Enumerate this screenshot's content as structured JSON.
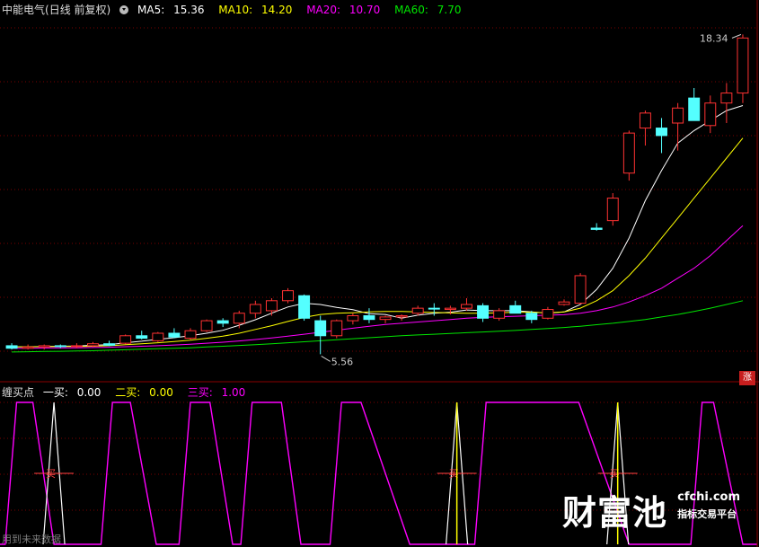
{
  "main_header": {
    "stock_name": "中能电气",
    "period": "(日线 前复权)",
    "ma5_label": "MA5:",
    "ma5_value": "15.36",
    "ma10_label": "MA10:",
    "ma10_value": "14.20",
    "ma20_label": "MA20:",
    "ma20_value": "10.70",
    "ma60_label": "MA60:",
    "ma60_value": "7.70"
  },
  "indicator_header": {
    "name": "缠买点",
    "buy1_label": "一买:",
    "buy1_value": "0.00",
    "buy2_label": "二买:",
    "buy2_value": "0.00",
    "buy3_label": "三买:",
    "buy3_value": "1.00"
  },
  "badges": {
    "rise": "涨"
  },
  "footer": {
    "no_future": "用到未来数据"
  },
  "watermark": {
    "brand": "财富池",
    "url": "cfchi.com",
    "slogan": "指标交易平台"
  },
  "colors": {
    "up": "#ff3232",
    "down": "#54ffff",
    "ma5": "#ffffff",
    "ma10": "#ffff00",
    "ma20": "#ff00ff",
    "ma60": "#00e600",
    "grid": "#7a0000",
    "buy1": "#ffffff",
    "buy2": "#ffff00",
    "buy3": "#ff00ff"
  },
  "chart_data": [
    {
      "type": "candlestick",
      "title": "中能电气 (日线 前复权)",
      "annotations": [
        {
          "text": "18.34",
          "x": 46,
          "y": 18.34
        },
        {
          "text": "5.56",
          "x": 20,
          "y": 5.56
        }
      ],
      "ylim": [
        5.0,
        19.0
      ],
      "x": [
        1,
        2,
        3,
        4,
        5,
        6,
        7,
        8,
        9,
        10,
        11,
        12,
        13,
        14,
        15,
        16,
        17,
        18,
        19,
        20,
        21,
        22,
        23,
        24,
        25,
        26,
        27,
        28,
        29,
        30,
        31,
        32,
        33,
        34,
        35,
        36,
        37,
        38,
        39,
        40,
        41,
        42,
        43,
        44,
        45,
        46
      ],
      "candles": [
        [
          5.9,
          6.0,
          5.75,
          5.8
        ],
        [
          5.8,
          5.95,
          5.75,
          5.85
        ],
        [
          5.85,
          5.95,
          5.75,
          5.9
        ],
        [
          5.9,
          5.95,
          5.8,
          5.88
        ],
        [
          5.88,
          6.0,
          5.8,
          5.9
        ],
        [
          5.9,
          6.05,
          5.85,
          5.98
        ],
        [
          5.98,
          6.1,
          5.88,
          5.92
        ],
        [
          6.0,
          6.35,
          5.95,
          6.3
        ],
        [
          6.3,
          6.5,
          6.15,
          6.2
        ],
        [
          6.1,
          6.45,
          6.05,
          6.4
        ],
        [
          6.4,
          6.6,
          6.2,
          6.25
        ],
        [
          6.2,
          6.6,
          6.15,
          6.5
        ],
        [
          6.5,
          6.95,
          6.45,
          6.9
        ],
        [
          6.9,
          7.0,
          6.65,
          6.8
        ],
        [
          6.8,
          7.3,
          6.6,
          7.2
        ],
        [
          7.2,
          7.7,
          7.0,
          7.55
        ],
        [
          7.3,
          7.8,
          7.1,
          7.7
        ],
        [
          7.7,
          8.2,
          7.6,
          8.1
        ],
        [
          7.9,
          7.95,
          6.9,
          7.0
        ],
        [
          6.9,
          7.1,
          5.56,
          6.3
        ],
        [
          6.3,
          6.95,
          6.2,
          6.9
        ],
        [
          6.9,
          7.2,
          6.75,
          7.1
        ],
        [
          7.1,
          7.4,
          6.8,
          6.95
        ],
        [
          6.95,
          7.1,
          6.8,
          7.05
        ],
        [
          7.05,
          7.15,
          6.9,
          7.1
        ],
        [
          7.2,
          7.5,
          7.1,
          7.4
        ],
        [
          7.4,
          7.6,
          7.1,
          7.38
        ],
        [
          7.35,
          7.5,
          7.15,
          7.4
        ],
        [
          7.4,
          7.8,
          7.3,
          7.55
        ],
        [
          7.5,
          7.6,
          6.85,
          7.0
        ],
        [
          7.0,
          7.4,
          6.9,
          7.3
        ],
        [
          7.5,
          7.7,
          7.3,
          7.2
        ],
        [
          7.2,
          7.3,
          6.8,
          6.95
        ],
        [
          7.0,
          7.45,
          6.95,
          7.35
        ],
        [
          7.55,
          7.75,
          7.5,
          7.65
        ],
        [
          7.6,
          8.8,
          7.55,
          8.7
        ],
        [
          10.6,
          10.8,
          10.5,
          10.55
        ],
        [
          10.9,
          12.0,
          10.7,
          11.8
        ],
        [
          12.8,
          14.5,
          12.5,
          14.4
        ],
        [
          14.6,
          15.3,
          13.9,
          15.2
        ],
        [
          14.6,
          15.0,
          13.6,
          14.3
        ],
        [
          14.8,
          15.6,
          13.7,
          15.4
        ],
        [
          15.8,
          16.2,
          14.9,
          14.9
        ],
        [
          14.7,
          15.9,
          14.4,
          15.6
        ],
        [
          15.6,
          16.4,
          14.8,
          16.0
        ],
        [
          16.0,
          18.34,
          15.6,
          18.2
        ]
      ],
      "series": [
        {
          "name": "MA5",
          "values": [
            5.85,
            5.86,
            5.87,
            5.88,
            5.89,
            5.92,
            5.94,
            6.02,
            6.08,
            6.16,
            6.22,
            6.3,
            6.4,
            6.52,
            6.72,
            6.94,
            7.2,
            7.45,
            7.6,
            7.55,
            7.43,
            7.34,
            7.18,
            7.15,
            7.0,
            7.12,
            7.2,
            7.24,
            7.33,
            7.3,
            7.3,
            7.3,
            7.25,
            7.2,
            7.25,
            7.55,
            8.15,
            9.0,
            10.2,
            11.7,
            12.9,
            14.0,
            14.5,
            14.9,
            15.3,
            15.5
          ]
        },
        {
          "name": "MA10",
          "values": [
            5.85,
            5.86,
            5.86,
            5.87,
            5.87,
            5.88,
            5.9,
            5.94,
            5.98,
            6.02,
            6.07,
            6.12,
            6.2,
            6.28,
            6.4,
            6.55,
            6.7,
            6.87,
            7.03,
            7.15,
            7.2,
            7.22,
            7.25,
            7.27,
            7.27,
            7.25,
            7.23,
            7.21,
            7.2,
            7.2,
            7.22,
            7.24,
            7.24,
            7.22,
            7.25,
            7.4,
            7.7,
            8.1,
            8.7,
            9.4,
            10.2,
            11.0,
            11.8,
            12.6,
            13.4,
            14.2
          ]
        },
        {
          "name": "MA20",
          "values": [
            5.8,
            5.8,
            5.81,
            5.81,
            5.82,
            5.83,
            5.84,
            5.86,
            5.88,
            5.9,
            5.93,
            5.96,
            6.0,
            6.04,
            6.09,
            6.15,
            6.21,
            6.28,
            6.36,
            6.44,
            6.52,
            6.6,
            6.68,
            6.75,
            6.8,
            6.85,
            6.9,
            6.95,
            7.0,
            7.03,
            7.06,
            7.08,
            7.1,
            7.12,
            7.14,
            7.2,
            7.3,
            7.45,
            7.65,
            7.9,
            8.2,
            8.6,
            9.0,
            9.5,
            10.1,
            10.7
          ]
        },
        {
          "name": "MA60",
          "values": [
            5.65,
            5.66,
            5.67,
            5.68,
            5.69,
            5.7,
            5.72,
            5.74,
            5.76,
            5.78,
            5.8,
            5.82,
            5.85,
            5.88,
            5.91,
            5.94,
            5.98,
            6.02,
            6.06,
            6.1,
            6.14,
            6.18,
            6.22,
            6.26,
            6.3,
            6.33,
            6.36,
            6.39,
            6.42,
            6.45,
            6.48,
            6.51,
            6.55,
            6.59,
            6.63,
            6.68,
            6.74,
            6.8,
            6.87,
            6.95,
            7.05,
            7.15,
            7.27,
            7.4,
            7.55,
            7.7
          ]
        }
      ]
    },
    {
      "type": "line",
      "title": "缠买点",
      "ylim": [
        0,
        1
      ],
      "series": [
        {
          "name": "一买",
          "markers": [
            3.6,
            28.4,
            38.3
          ],
          "marker_label": "一买"
        },
        {
          "name": "二买",
          "markers": [
            28.4,
            38.3
          ]
        },
        {
          "name": "三买",
          "pulses": [
            [
              1.3,
              2.3,
              3.6
            ],
            [
              7.2,
              8.3,
              9.9
            ],
            [
              12.0,
              13.2,
              14.6
            ],
            [
              15.8,
              17.6,
              18.8
            ],
            [
              21.3,
              22.5,
              25.5
            ],
            [
              30.2,
              35.9,
              39.0
            ],
            [
              43.5,
              44.2,
              46.0
            ]
          ]
        }
      ]
    }
  ]
}
